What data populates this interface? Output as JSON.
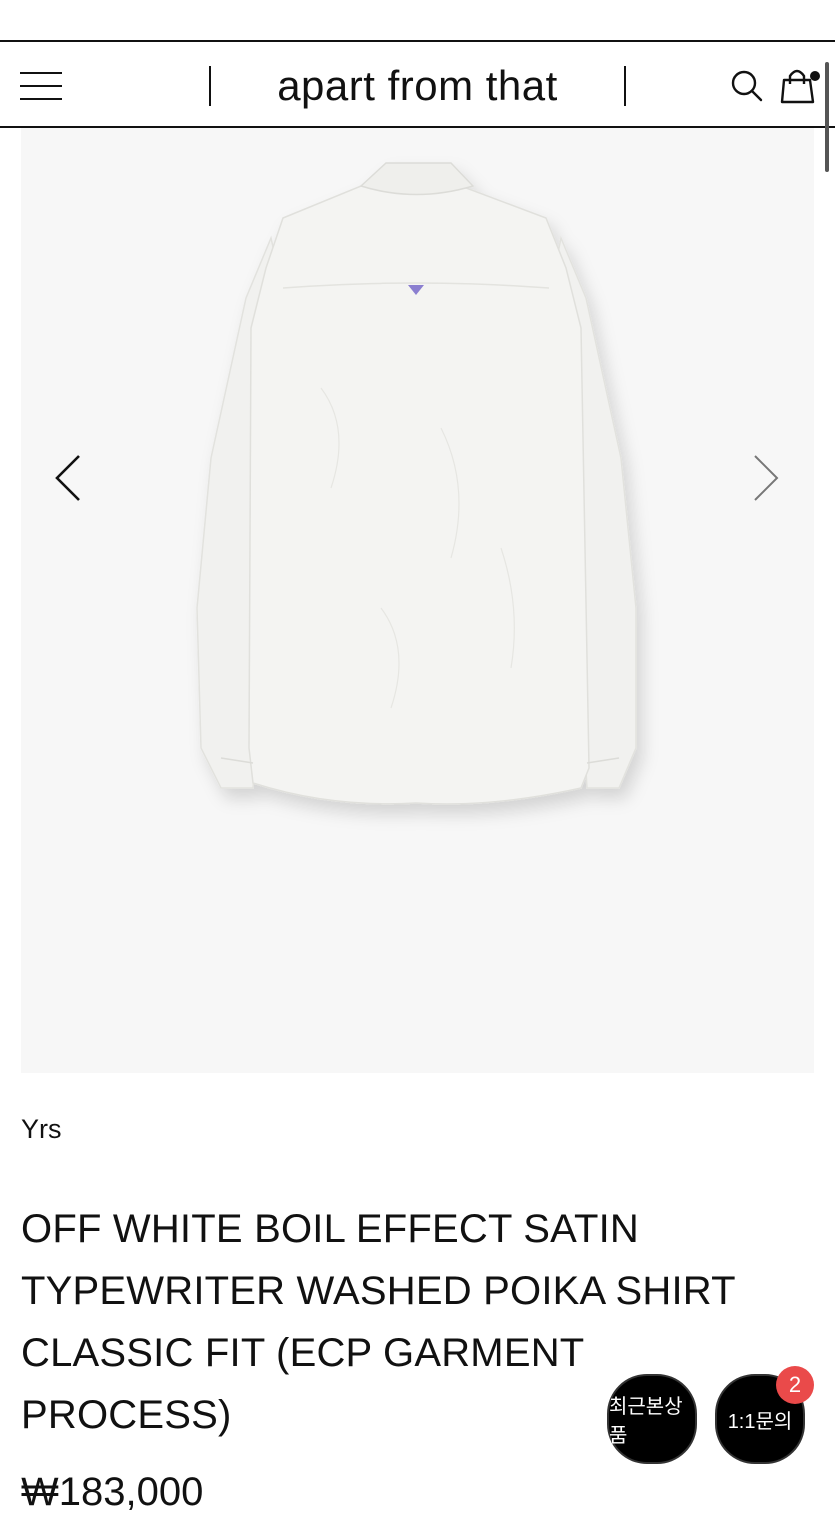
{
  "header": {
    "brand": "apart from that",
    "menu_icon": "hamburger-menu-icon",
    "search_icon": "search-icon",
    "cart_icon": "shopping-bag-icon"
  },
  "gallery": {
    "prev_icon": "chevron-left-icon",
    "next_icon": "chevron-right-icon",
    "image_alt": "white shirt back view"
  },
  "product": {
    "brand": "Yrs",
    "title_lines": [
      "OFF WHITE BOIL EFFECT SATIN",
      "TYPEWRITER WASHED POIKA SHIRT",
      "CLASSIC FIT (ECP GARMENT",
      "PROCESS)"
    ],
    "price": "₩183,000"
  },
  "floating": {
    "recent_label": "최근본상품",
    "inquiry_label": "1:1문의",
    "inquiry_badge": "2"
  },
  "colors": {
    "accent": "#111111",
    "badge": "#ea4a4a",
    "gallery_bg": "#f7f7f7"
  }
}
